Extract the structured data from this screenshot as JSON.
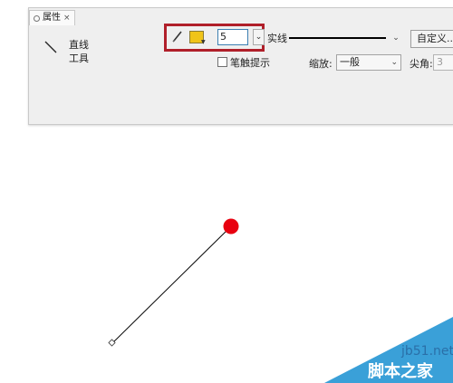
{
  "panel": {
    "tab_label": "属性",
    "tab_close": "×",
    "tool_name": "直线工具",
    "tool_icon": "line-tool-icon"
  },
  "stroke": {
    "color": "#f0c419",
    "width_value": "5",
    "spin_glyph": "⌄",
    "style_label": "实线",
    "style_arrow": "⌄"
  },
  "buttons": {
    "custom_label": "自定义..."
  },
  "options": {
    "stroke_hint_label": "笔触提示",
    "stroke_hint_checked": false,
    "scale_label": "缩放:",
    "scale_value": "一般",
    "scale_arrow": "⌄",
    "corner_label": "尖角:",
    "corner_value": "3"
  },
  "highlight": {
    "color": "#b01f2a"
  },
  "canvas": {
    "line_color": "#000000",
    "endpoint_color": "#e8000f"
  },
  "watermark": {
    "site": "jb51.net",
    "name": "脚本之家",
    "color": "#3aa0d8"
  }
}
